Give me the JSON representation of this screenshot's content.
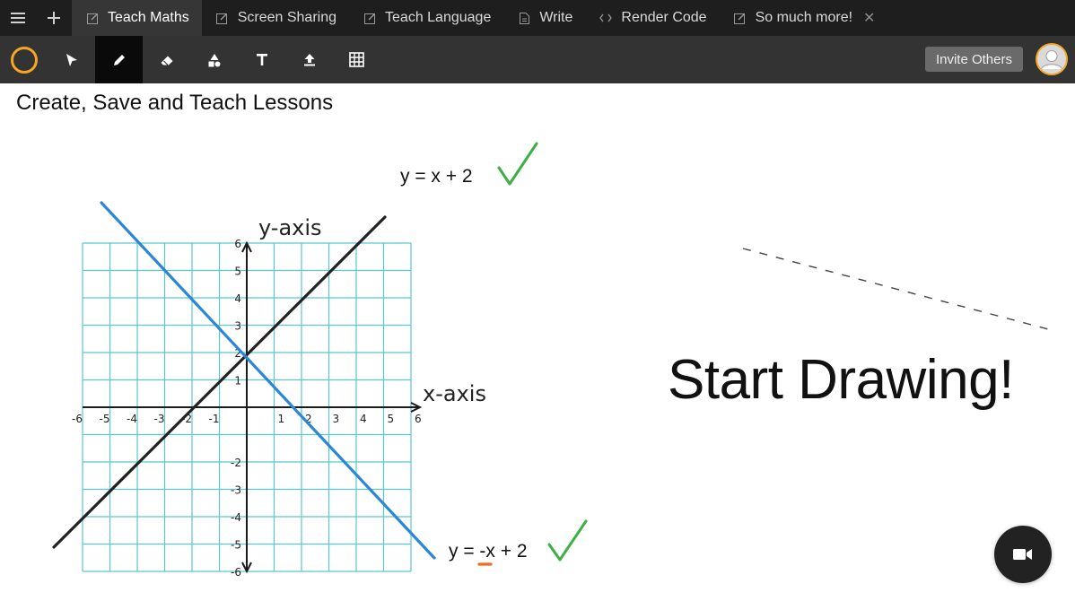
{
  "tabbar": {
    "menu_icon": "hamburger-menu-icon",
    "add_icon": "plus-icon",
    "tabs": [
      {
        "label": "Teach Maths",
        "icon": "edit-icon",
        "active": true
      },
      {
        "label": "Screen Sharing",
        "icon": "edit-icon"
      },
      {
        "label": "Teach Language",
        "icon": "edit-icon"
      },
      {
        "label": "Write",
        "icon": "document-icon"
      },
      {
        "label": "Render Code",
        "icon": "code-icon"
      },
      {
        "label": "So much more!",
        "icon": "edit-icon"
      }
    ]
  },
  "toolbar": {
    "color": "#f5a623",
    "tools": [
      "color-picker",
      "select-arrow",
      "pencil",
      "eraser",
      "shapes",
      "text",
      "upload",
      "grid"
    ],
    "active_tool": "pencil",
    "invite_label": "Invite Others"
  },
  "canvas": {
    "title": "Create, Save and Teach Lessons",
    "start_text": "Start Drawing!",
    "eq1": "y = x + 2",
    "eq2": "y = -x + 2",
    "check_color": "#3cb043",
    "underline_color": "#f26b1d"
  },
  "graph": {
    "y_axis_label": "y-axis",
    "x_axis_label": "x-axis",
    "x_ticks": [
      "-6",
      "-5",
      "-4",
      "-3",
      "-2",
      "-1",
      "1",
      "2",
      "3",
      "4",
      "5",
      "6"
    ],
    "y_ticks": [
      "6",
      "5",
      "4",
      "3",
      "2",
      "1",
      "-2",
      "-3",
      "-4",
      "-5",
      "-6"
    ],
    "grid_color": "#5bc6d0",
    "line1_color": "#222222",
    "line2_color": "#2a86d9"
  }
}
